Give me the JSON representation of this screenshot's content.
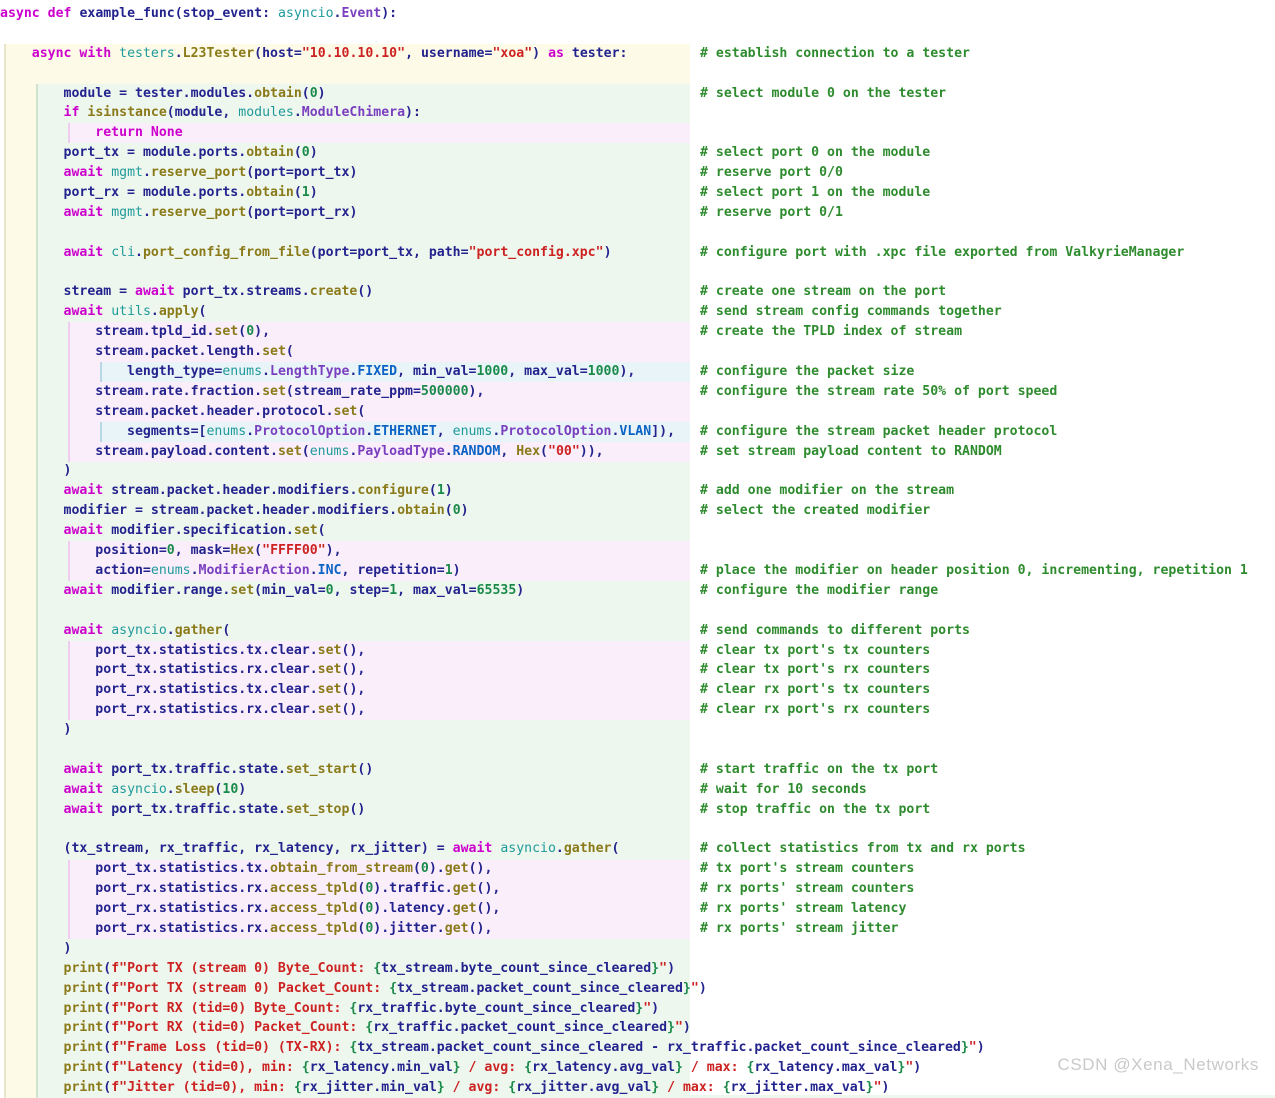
{
  "app": {
    "kind": "code-snippet",
    "language": "Python",
    "watermark": "CSDN @Xena_Networks"
  },
  "theme": {
    "background": "#ffffff",
    "keyword": "#cc00cc",
    "identifier": "#23238e",
    "module": "#1f9a9a",
    "class": "#7a3fbf",
    "method": "#8a7a1a",
    "number": "#1a8a4a",
    "string": "#cc2222",
    "comment": "#2e8b2e",
    "param": "#8c8c8c",
    "guide_level1": "#fdfbe8",
    "guide_level2": "#eef7ee",
    "guide_level3": "#fbeefb",
    "guide_level4": "#e8f4f8"
  },
  "code": {
    "title": "example_func",
    "lines": [
      {
        "n": 1,
        "indent": 0,
        "text": "async def example_func(stop_event: asyncio.Event):",
        "comment": ""
      },
      {
        "n": 2,
        "indent": 0,
        "text": "",
        "comment": ""
      },
      {
        "n": 3,
        "indent": 1,
        "text": "async with testers.L23Tester(host=\"10.10.10.10\", username=\"xoa\") as tester:",
        "comment": "# establish connection to a tester"
      },
      {
        "n": 4,
        "indent": 2,
        "text": "",
        "comment": ""
      },
      {
        "n": 5,
        "indent": 2,
        "text": "module = tester.modules.obtain(0)",
        "comment": "# select module 0 on the tester"
      },
      {
        "n": 6,
        "indent": 2,
        "text": "if isinstance(module, modules.ModuleChimera):",
        "comment": ""
      },
      {
        "n": 7,
        "indent": 3,
        "text": "return None",
        "comment": ""
      },
      {
        "n": 8,
        "indent": 2,
        "text": "port_tx = module.ports.obtain(0)",
        "comment": "# select port 0 on the module"
      },
      {
        "n": 9,
        "indent": 2,
        "text": "await mgmt.reserve_port(port=port_tx)",
        "comment": "# reserve port 0/0"
      },
      {
        "n": 10,
        "indent": 2,
        "text": "port_rx = module.ports.obtain(1)",
        "comment": "# select port 1 on the module"
      },
      {
        "n": 11,
        "indent": 2,
        "text": "await mgmt.reserve_port(port=port_rx)",
        "comment": "# reserve port 0/1"
      },
      {
        "n": 12,
        "indent": 2,
        "text": "",
        "comment": ""
      },
      {
        "n": 13,
        "indent": 2,
        "text": "await cli.port_config_from_file(port=port_tx, path=\"port_config.xpc\")",
        "comment": "# configure port with .xpc file exported from ValkyrieManager"
      },
      {
        "n": 14,
        "indent": 2,
        "text": "",
        "comment": ""
      },
      {
        "n": 15,
        "indent": 2,
        "text": "stream = await port_tx.streams.create()",
        "comment": "# create one stream on the port"
      },
      {
        "n": 16,
        "indent": 2,
        "text": "await utils.apply(",
        "comment": "# send stream config commands together"
      },
      {
        "n": 17,
        "indent": 3,
        "text": "stream.tpld_id.set(0),",
        "comment": "# create the TPLD index of stream"
      },
      {
        "n": 18,
        "indent": 3,
        "text": "stream.packet.length.set(",
        "comment": ""
      },
      {
        "n": 19,
        "indent": 4,
        "text": "length_type=enums.LengthType.FIXED, min_val=1000, max_val=1000),",
        "comment": "# configure the packet size"
      },
      {
        "n": 20,
        "indent": 3,
        "text": "stream.rate.fraction.set(stream_rate_ppm=500000),",
        "comment": "# configure the stream rate 50% of port speed"
      },
      {
        "n": 21,
        "indent": 3,
        "text": "stream.packet.header.protocol.set(",
        "comment": ""
      },
      {
        "n": 22,
        "indent": 4,
        "text": "segments=[enums.ProtocolOption.ETHERNET, enums.ProtocolOption.VLAN]),",
        "comment": "# configure the stream packet header protocol"
      },
      {
        "n": 23,
        "indent": 3,
        "text": "stream.payload.content.set(enums.PayloadType.RANDOM, Hex(\"00\")),",
        "comment": "# set stream payload content to RANDOM"
      },
      {
        "n": 24,
        "indent": 2,
        "text": ")",
        "comment": ""
      },
      {
        "n": 25,
        "indent": 2,
        "text": "await stream.packet.header.modifiers.configure(1)",
        "comment": "# add one modifier on the stream"
      },
      {
        "n": 26,
        "indent": 2,
        "text": "modifier = stream.packet.header.modifiers.obtain(0)",
        "comment": "# select the created modifier"
      },
      {
        "n": 27,
        "indent": 2,
        "text": "await modifier.specification.set(",
        "comment": ""
      },
      {
        "n": 28,
        "indent": 3,
        "text": "position=0, mask=Hex(\"FFFF00\"),",
        "comment": ""
      },
      {
        "n": 29,
        "indent": 3,
        "text": "action=enums.ModifierAction.INC, repetition=1)",
        "comment": "# place the modifier on header position 0, incrementing, repetition 1"
      },
      {
        "n": 30,
        "indent": 2,
        "text": "await modifier.range.set(min_val=0, step=1, max_val=65535)",
        "comment": "# configure the modifier range"
      },
      {
        "n": 31,
        "indent": 2,
        "text": "",
        "comment": ""
      },
      {
        "n": 32,
        "indent": 2,
        "text": "await asyncio.gather(",
        "comment": "# send commands to different ports"
      },
      {
        "n": 33,
        "indent": 3,
        "text": "port_tx.statistics.tx.clear.set(),",
        "comment": "# clear tx port's tx counters"
      },
      {
        "n": 34,
        "indent": 3,
        "text": "port_tx.statistics.rx.clear.set(),",
        "comment": "# clear tx port's rx counters"
      },
      {
        "n": 35,
        "indent": 3,
        "text": "port_rx.statistics.tx.clear.set(),",
        "comment": "# clear rx port's tx counters"
      },
      {
        "n": 36,
        "indent": 3,
        "text": "port_rx.statistics.rx.clear.set(),",
        "comment": "# clear rx port's rx counters"
      },
      {
        "n": 37,
        "indent": 2,
        "text": ")",
        "comment": ""
      },
      {
        "n": 38,
        "indent": 2,
        "text": "",
        "comment": ""
      },
      {
        "n": 39,
        "indent": 2,
        "text": "await port_tx.traffic.state.set_start()",
        "comment": "# start traffic on the tx port"
      },
      {
        "n": 40,
        "indent": 2,
        "text": "await asyncio.sleep(10)",
        "comment": "# wait for 10 seconds"
      },
      {
        "n": 41,
        "indent": 2,
        "text": "await port_tx.traffic.state.set_stop()",
        "comment": "# stop traffic on the tx port"
      },
      {
        "n": 42,
        "indent": 2,
        "text": "",
        "comment": ""
      },
      {
        "n": 43,
        "indent": 2,
        "text": "(tx_stream, rx_traffic, rx_latency, rx_jitter) = await asyncio.gather(",
        "comment": "# collect statistics from tx and rx ports"
      },
      {
        "n": 44,
        "indent": 3,
        "text": "port_tx.statistics.tx.obtain_from_stream(0).get(),",
        "comment": "# tx port's stream counters"
      },
      {
        "n": 45,
        "indent": 3,
        "text": "port_rx.statistics.rx.access_tpld(0).traffic.get(),",
        "comment": "# rx ports' stream counters"
      },
      {
        "n": 46,
        "indent": 3,
        "text": "port_rx.statistics.rx.access_tpld(0).latency.get(),",
        "comment": "# rx ports' stream latency"
      },
      {
        "n": 47,
        "indent": 3,
        "text": "port_rx.statistics.rx.access_tpld(0).jitter.get(),",
        "comment": "# rx ports' stream jitter"
      },
      {
        "n": 48,
        "indent": 2,
        "text": ")",
        "comment": ""
      },
      {
        "n": 49,
        "indent": 2,
        "text": "print(f\"Port TX (stream 0) Byte_Count: {tx_stream.byte_count_since_cleared}\")",
        "comment": ""
      },
      {
        "n": 50,
        "indent": 2,
        "text": "print(f\"Port TX (stream 0) Packet_Count: {tx_stream.packet_count_since_cleared}\")",
        "comment": ""
      },
      {
        "n": 51,
        "indent": 2,
        "text": "print(f\"Port RX (tid=0) Byte_Count: {rx_traffic.byte_count_since_cleared}\")",
        "comment": ""
      },
      {
        "n": 52,
        "indent": 2,
        "text": "print(f\"Port RX (tid=0) Packet_Count: {rx_traffic.packet_count_since_cleared}\")",
        "comment": ""
      },
      {
        "n": 53,
        "indent": 2,
        "text": "print(f\"Frame Loss (tid=0) (TX-RX): {tx_stream.packet_count_since_cleared - rx_traffic.packet_count_since_cleared}\")",
        "comment": ""
      },
      {
        "n": 54,
        "indent": 2,
        "text": "print(f\"Latency (tid=0), min: {rx_latency.min_val} / avg: {rx_latency.avg_val} / max: {rx_latency.max_val}\")",
        "comment": ""
      },
      {
        "n": 55,
        "indent": 2,
        "text": "print(f\"Jitter (tid=0), min: {rx_jitter.min_val} / avg: {rx_jitter.avg_val} / max: {rx_jitter.max_val}\")",
        "comment": ""
      }
    ]
  }
}
